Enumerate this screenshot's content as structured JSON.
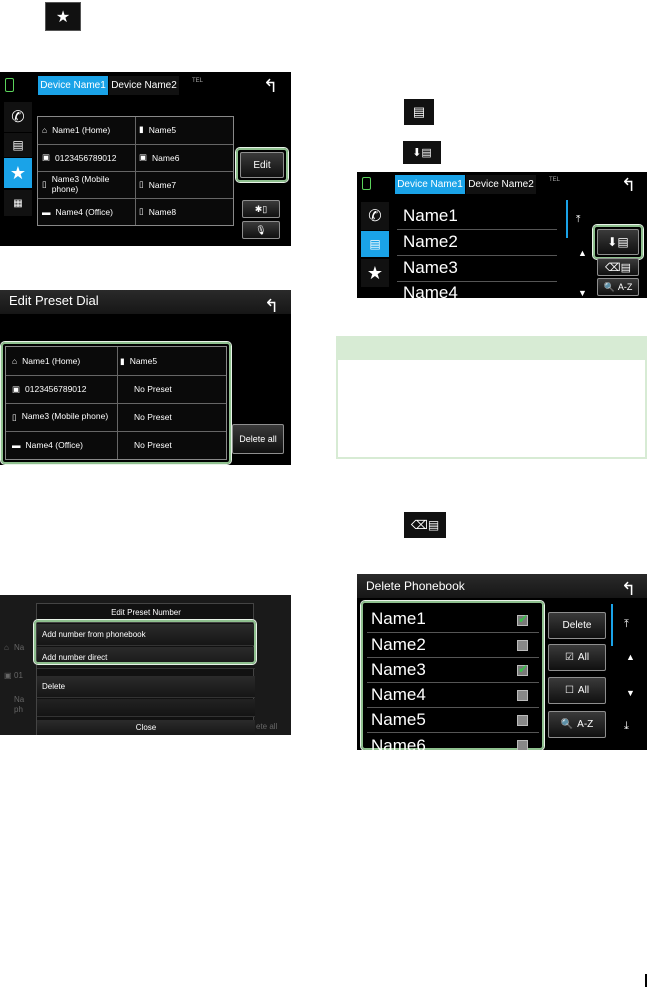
{
  "colors": {
    "accent": "#1aa3e8",
    "highlight": "#8fc08f",
    "note_header": "#d7ebd4"
  },
  "top_star_icon": "star-icon",
  "screen1": {
    "tabs": [
      "Device Name1",
      "Device Name2"
    ],
    "status": "TEL",
    "cells": [
      [
        "Name1 (Home)",
        "Name5"
      ],
      [
        "0123456789012",
        "Name6"
      ],
      [
        "Name3 (Mobile phone)",
        "Name7"
      ],
      [
        "Name4 (Office)",
        "Name8"
      ]
    ],
    "edit_label": "Edit"
  },
  "screen2": {
    "title": "Edit Preset Dial",
    "cells": [
      [
        "Name1 (Home)",
        "Name5"
      ],
      [
        "0123456789012",
        "No Preset"
      ],
      [
        "Name3 (Mobile phone)",
        "No Preset"
      ],
      [
        "Name4 (Office)",
        "No Preset"
      ]
    ],
    "delete_all": "Delete all"
  },
  "screen3": {
    "title": "Edit Preset Number",
    "items": [
      "Add number from phonebook",
      "Add number direct",
      "Delete"
    ],
    "close": "Close",
    "bg_fragments": [
      "Na",
      "01",
      "Na",
      "ph",
      "ete all"
    ]
  },
  "screen4": {
    "tabs": [
      "Device Name1",
      "Device Name2"
    ],
    "status": "TEL",
    "names": [
      "Name1",
      "Name2",
      "Name3",
      "Name4"
    ],
    "az": "A-Z"
  },
  "screen5": {
    "title": "Delete Phonebook",
    "names": [
      "Name1",
      "Name2",
      "Name3",
      "Name4",
      "Name5",
      "Name6"
    ],
    "checked": [
      true,
      false,
      true,
      false,
      false,
      false
    ],
    "delete": "Delete",
    "all_check": "All",
    "all_uncheck": "All",
    "az": "A-Z"
  }
}
